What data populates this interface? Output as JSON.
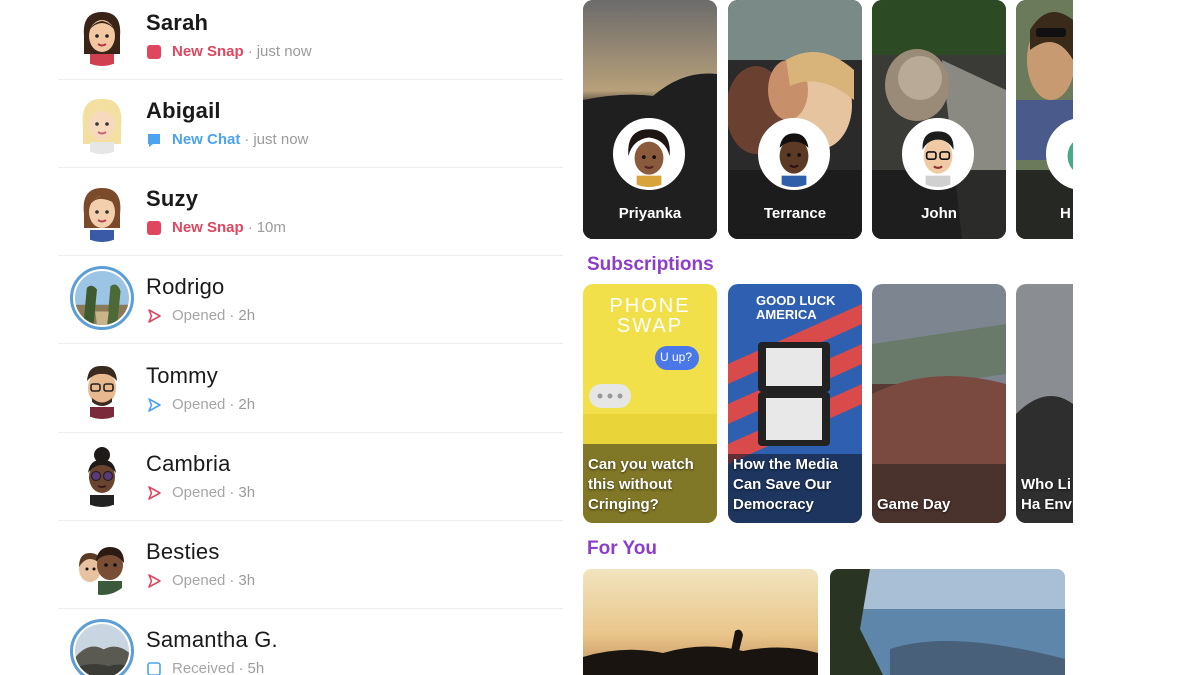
{
  "chats": [
    {
      "name": "Sarah",
      "status": "New Snap",
      "time": "just now",
      "type": "new-snap"
    },
    {
      "name": "Abigail",
      "status": "New Chat",
      "time": "just now",
      "type": "new-chat"
    },
    {
      "name": "Suzy",
      "status": "New Snap",
      "time": "10m",
      "type": "new-snap"
    },
    {
      "name": "Rodrigo",
      "status": "Opened",
      "time": "2h",
      "type": "opened-red"
    },
    {
      "name": "Tommy",
      "status": "Opened",
      "time": "2h",
      "type": "opened-blue"
    },
    {
      "name": "Cambria",
      "status": "Opened",
      "time": "3h",
      "type": "opened-red"
    },
    {
      "name": "Besties",
      "status": "Opened",
      "time": "3h",
      "type": "opened-red"
    },
    {
      "name": "Samantha G.",
      "status": "Received",
      "time": "5h",
      "type": "received-blue"
    }
  ],
  "separator": "·",
  "friends_stories": [
    {
      "name": "Priyanka"
    },
    {
      "name": "Terrance"
    },
    {
      "name": "John"
    },
    {
      "name": "H"
    }
  ],
  "subscriptions": {
    "title": "Subscriptions",
    "cards": [
      {
        "caption": "Can you watch this without Cringing?",
        "overlay_top": "PHONE SWAP",
        "bubble": "U up?"
      },
      {
        "caption": "How the Media Can Save Our Democracy",
        "overlay_top": "GOOD LUCK AMERICA"
      },
      {
        "caption": "Game Day"
      },
      {
        "caption": "Who Li This Ha Enviro"
      }
    ]
  },
  "for_you": {
    "title": "For You"
  },
  "colors": {
    "snap_red": "#e0475f",
    "chat_blue": "#4da3f0",
    "section_purple": "#8c3ec9",
    "story_ring_blue": "#5c9ed8"
  }
}
